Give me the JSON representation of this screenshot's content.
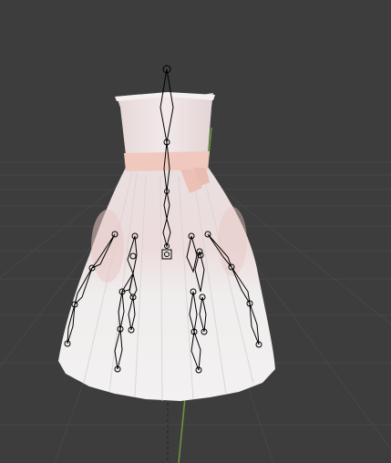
{
  "viewport": {
    "background": "#3d3d3d",
    "grid_color": "#4a4a4a",
    "y_axis_color": "#6f9a3a",
    "z_axis_color": "#2e2e2e"
  },
  "mesh": {
    "name": "dress",
    "base_color": "#ece6e6",
    "shade_color": "#d8cfcf",
    "sash_color": "#f2c9c0",
    "blush_color": "#e6c7c2"
  },
  "armature": {
    "bone_stroke": "#000000",
    "bone_fill": "none",
    "icons": [
      "bone-icon",
      "joint-icon"
    ]
  }
}
